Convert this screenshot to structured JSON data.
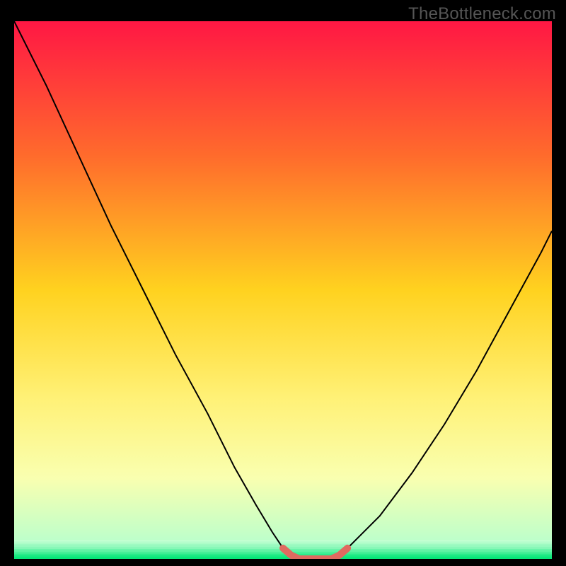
{
  "watermark": "TheBottleneck.com",
  "chart_data": {
    "type": "line",
    "title": "",
    "xlabel": "",
    "ylabel": "",
    "xlim": [
      0,
      100
    ],
    "ylim": [
      0,
      100
    ],
    "background": {
      "kind": "vertical-gradient",
      "stops": [
        {
          "pos": 0.0,
          "color": "#ff1744"
        },
        {
          "pos": 0.25,
          "color": "#ff6b2c"
        },
        {
          "pos": 0.5,
          "color": "#ffd21f"
        },
        {
          "pos": 0.7,
          "color": "#fff176"
        },
        {
          "pos": 0.85,
          "color": "#f9ffb0"
        },
        {
          "pos": 0.98,
          "color": "#b6ffce"
        },
        {
          "pos": 1.0,
          "color": "#00e676"
        }
      ]
    },
    "series": [
      {
        "name": "curve",
        "color": "#000000",
        "width": 2,
        "x": [
          0,
          6,
          12,
          18,
          24,
          30,
          36,
          41,
          45,
          48,
          50,
          53,
          56,
          59,
          62,
          68,
          74,
          80,
          86,
          92,
          98,
          100
        ],
        "y": [
          100,
          88,
          75,
          62,
          50,
          38,
          27,
          17,
          10,
          5,
          2,
          0,
          0,
          0,
          2,
          8,
          16,
          25,
          35,
          46,
          57,
          61
        ]
      },
      {
        "name": "sweet-spot",
        "color": "#e06a60",
        "width": 10,
        "linecap": "round",
        "x": [
          50,
          51.5,
          53,
          55,
          57,
          59,
          60.5,
          62
        ],
        "y": [
          2,
          0.7,
          0,
          0,
          0,
          0,
          0.7,
          2
        ]
      }
    ],
    "banding": {
      "start_y_pct": 0.965,
      "end_y_pct": 0.998,
      "bands": 14,
      "from_color": "#c8ffd6",
      "to_color": "#00e676"
    }
  }
}
